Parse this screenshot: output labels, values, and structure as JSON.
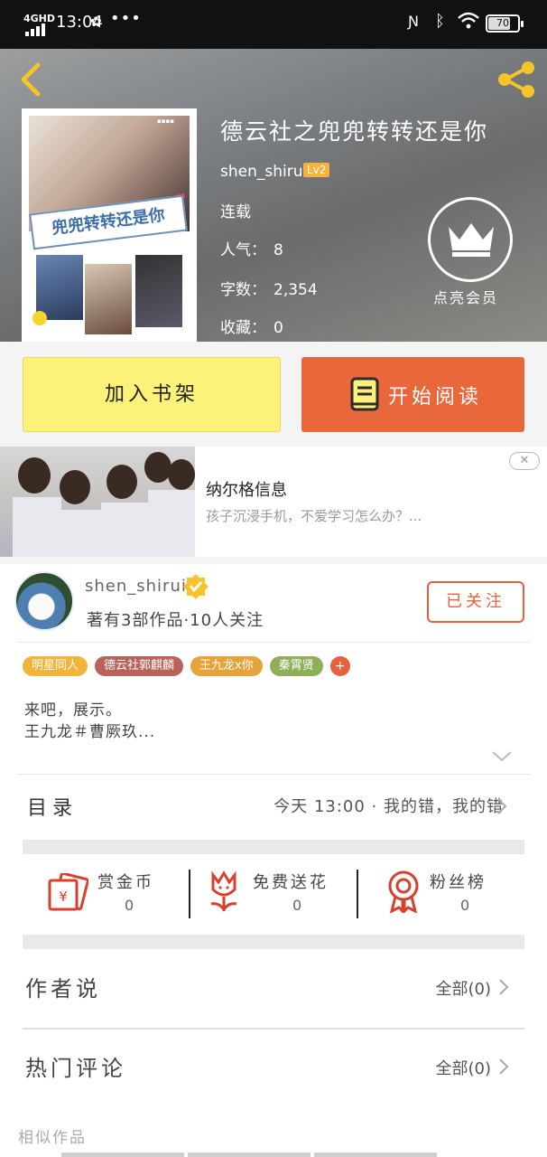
{
  "status_bar": {
    "network": "4GHD",
    "time": "13:04",
    "battery": "70",
    "battery_level": 0.7,
    "icons": [
      "signal-icon",
      "wechat-icon",
      "more-dots-icon",
      "nfc-icon",
      "bluetooth-icon",
      "wifi-icon",
      "battery-icon"
    ]
  },
  "book": {
    "title": "德云社之兜兜转转还是你",
    "cover_caption": "兜兜转转还是你",
    "author": "shen_shirui",
    "level": "Lv2",
    "status": "连载",
    "popularity_label": "人气：",
    "popularity": "8",
    "words_label": "字数：",
    "words": "2,354",
    "favorites_label": "收藏：",
    "favorites": "0"
  },
  "vip": {
    "label": "点亮会员"
  },
  "actions": {
    "shelf_label": "加入书架",
    "read_label": "开始阅读"
  },
  "ad": {
    "title": "纳尔格信息",
    "description": "孩子沉浸手机，不爱学习怎么办？..."
  },
  "author_card": {
    "name": "shen_shirui",
    "stats": "著有3部作品·10人关注",
    "follow_label": "已关注"
  },
  "tags": [
    {
      "label": "明星同人",
      "color": "#f3b43a"
    },
    {
      "label": "德云社郭麒麟",
      "color": "#b8625a"
    },
    {
      "label": "王九龙x你",
      "color": "#e6a33a"
    },
    {
      "label": "秦霄贤",
      "color": "#8fae5a"
    },
    {
      "label": "+",
      "color": "#e8603c"
    }
  ],
  "description": {
    "line1": "来吧，展示。",
    "line2": "王九龙＃曹厥玖..."
  },
  "toc": {
    "label": "目录",
    "latest": "今天 13:00 · 我的错，我的错"
  },
  "stats": [
    {
      "label": "赏金币",
      "value": "0",
      "icon": "coin-envelope-icon"
    },
    {
      "label": "免费送花",
      "value": "0",
      "icon": "flower-icon"
    },
    {
      "label": "粉丝榜",
      "value": "0",
      "icon": "medal-icon"
    }
  ],
  "author_says": {
    "label": "作者说",
    "more": "全部(0)"
  },
  "hot_comments": {
    "label": "热门评论",
    "more": "全部(0)"
  },
  "similar": {
    "label": "相似作品"
  },
  "colors": {
    "accent": "#e8683c",
    "shelf_button": "#fcf27a",
    "lv_badge": "#f5b23c",
    "icon_yellow": "#f5c42b",
    "icon_red": "#d6402c"
  }
}
